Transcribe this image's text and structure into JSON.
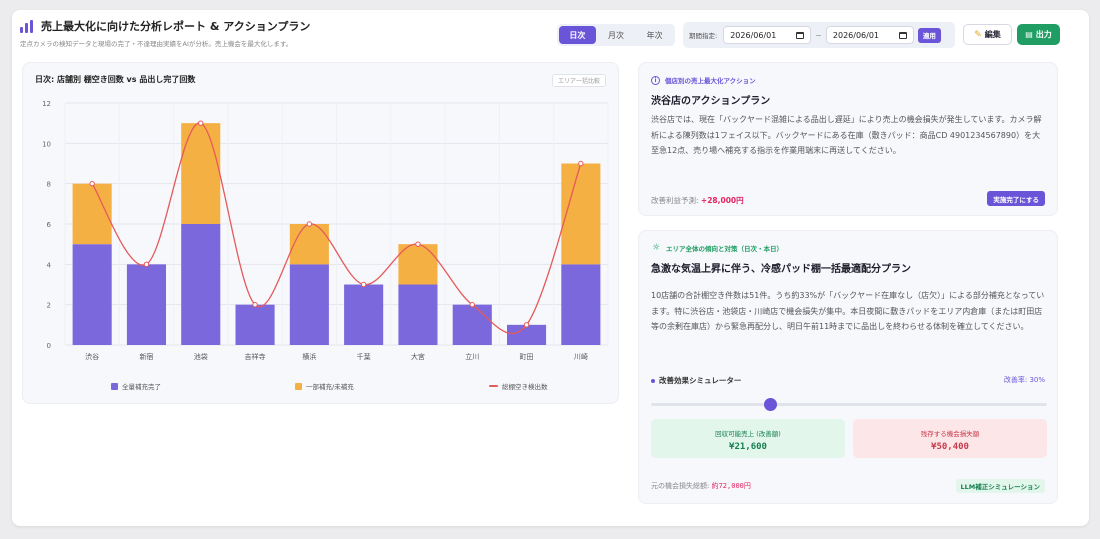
{
  "header": {
    "title": "売上最大化に向けた分析レポート & アクションプラン",
    "subtitle": "定点カメラの検知データと現場の完了・不達理由実績をAIが分析。売上機会を最大化します。"
  },
  "view_tabs": [
    {
      "label": "日次",
      "active": true
    },
    {
      "label": "月次",
      "active": false
    },
    {
      "label": "年次",
      "active": false
    }
  ],
  "period": {
    "label": "期間指定:",
    "start": "2026/06/01",
    "separator": "~",
    "end": "2026/06/01",
    "apply_label": "適用"
  },
  "toolbar": {
    "edit_label": "編集",
    "export_label": "出力"
  },
  "chart_panel": {
    "title": "日次: 店舗別 棚空き回数 vs 品出し完了回数",
    "badge": "エリア一括比較"
  },
  "chart_data": {
    "type": "bar",
    "stacked": true,
    "categories": [
      "渋谷",
      "新宿",
      "池袋",
      "吉祥寺",
      "横浜",
      "千葉",
      "大宮",
      "立川",
      "町田",
      "川崎"
    ],
    "series": [
      {
        "name": "全量補充完了",
        "type": "bar",
        "color": "#7b68dc",
        "values": [
          5,
          4,
          6,
          2,
          4,
          3,
          3,
          2,
          1,
          4
        ]
      },
      {
        "name": "一部補充/未補充",
        "type": "bar",
        "color": "#f5b043",
        "values": [
          3,
          0,
          5,
          0,
          2,
          0,
          2,
          0,
          0,
          5
        ]
      },
      {
        "name": "総棚空き検出数",
        "type": "line",
        "color": "#e55a5a",
        "values": [
          8,
          4,
          11,
          2,
          6,
          3,
          5,
          2,
          1,
          9
        ]
      }
    ],
    "yticks": [
      0,
      2,
      4,
      6,
      8,
      10,
      12
    ],
    "ylim": [
      0,
      12
    ],
    "grid": true,
    "legend_position": "bottom"
  },
  "action": {
    "label": "個店別の売上最大化アクション",
    "title": "渋谷店のアクションプラン",
    "body": "渋谷店では、現在「バックヤード混雑による品出し遅延」により売上の機会損失が発生しています。カメラ解析による陳列数は1フェイス以下。バックヤードにある在庫（敷きパッド：商品CD 4901234567890）を大至急12点、売り場へ補充する指示を作業用端末に再送してください。",
    "profit_label": "改善利益予測:",
    "profit_value": "+28,000円",
    "done_label": "実施完了にする"
  },
  "trend": {
    "label": "エリア全体の傾向と対策（日次・本日）",
    "title": "急激な気温上昇に伴う、冷感パッド棚一括最適配分プラン",
    "body": "10店舗の合計棚空き件数は51件。うち約33%が「バックヤード在庫なし（店欠）」による部分補充となっています。特に渋谷店・池袋店・川崎店で機会損失が集中。本日夜間に敷きパッドをエリア内倉庫（または町田店等の余剰在庫店）から緊急再配分し、明日午前11時までに品出しを終わらせる体制を確立してください。",
    "sim_label": "改善効果シミュレーター",
    "rate_label": "改善率:",
    "rate_value": "30%",
    "slider_value": 0.3,
    "recover_label": "回収可能売上 (改善額)",
    "recover_value": "¥21,600",
    "remain_label": "残存する機会損失額",
    "remain_value": "¥50,400",
    "loss_label": "元の機会損失総額:",
    "loss_value": "約72,000円",
    "llm_label": "LLM補正シミュレーション"
  },
  "colors": {
    "accent": "#6a54d8",
    "bar_complete": "#7b68dc",
    "bar_partial": "#f5b043",
    "line": "#e55a5a",
    "export": "#1f9d63"
  }
}
